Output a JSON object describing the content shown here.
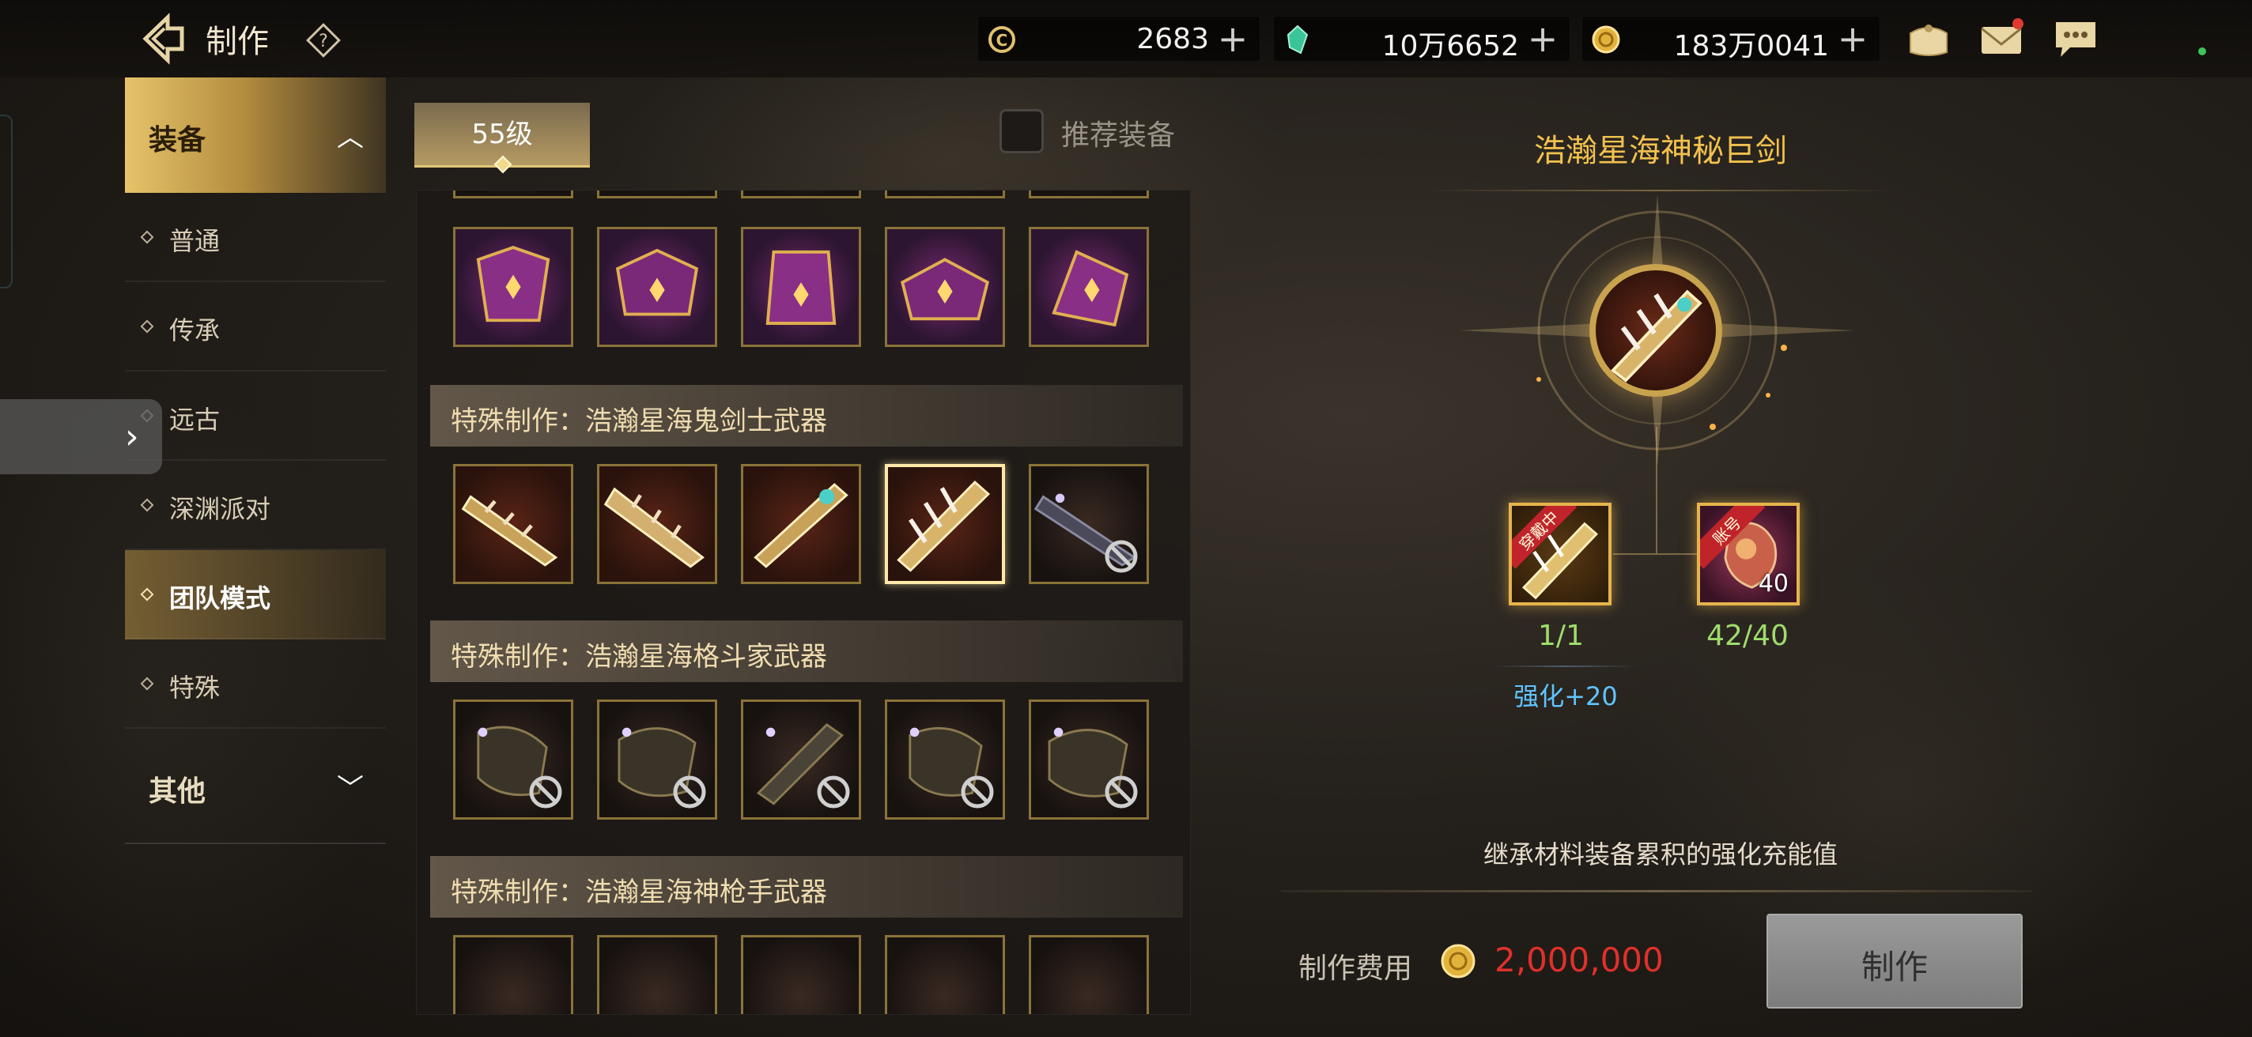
{
  "header": {
    "title": "制作",
    "currencies": [
      {
        "name": "c-coin-icon",
        "value": "2683",
        "color": "#e0c070"
      },
      {
        "name": "crystal-icon",
        "value": "10万6652",
        "color": "#3bc49a"
      },
      {
        "name": "gold-coin-icon",
        "value": "183万0041",
        "color": "#e2b33c"
      }
    ]
  },
  "nav": {
    "category_equipment": "装备",
    "items": [
      {
        "label": "普通"
      },
      {
        "label": "传承"
      },
      {
        "label": "远古"
      },
      {
        "label": "深渊派对"
      },
      {
        "label": "团队模式"
      },
      {
        "label": "特殊"
      }
    ],
    "category_other": "其他"
  },
  "filters": {
    "level_tab": "55级",
    "recommend_label": "推荐装备"
  },
  "sections": [
    {
      "title": "特殊制作：浩瀚星海鬼剑士武器"
    },
    {
      "title": "特殊制作：浩瀚星海格斗家武器"
    },
    {
      "title": "特殊制作：浩瀚星海神枪手武器"
    }
  ],
  "detail": {
    "item_name": "浩瀚星海神秘巨剑",
    "materials": [
      {
        "count": "1/1",
        "ribbon": "穿戴中",
        "enhance": "强化+20"
      },
      {
        "count": "42/40",
        "ribbon": "账号",
        "qty": "40"
      }
    ],
    "inherit_note": "继承材料装备累积的强化充能值",
    "cost_label": "制作费用",
    "cost_value": "2,000,000",
    "make_button": "制作"
  },
  "colors": {
    "accent_gold": "#f2c14e",
    "cost_red": "#e0302a",
    "count_green": "#9fdc6c",
    "enhance_blue": "#5fc4ff"
  }
}
